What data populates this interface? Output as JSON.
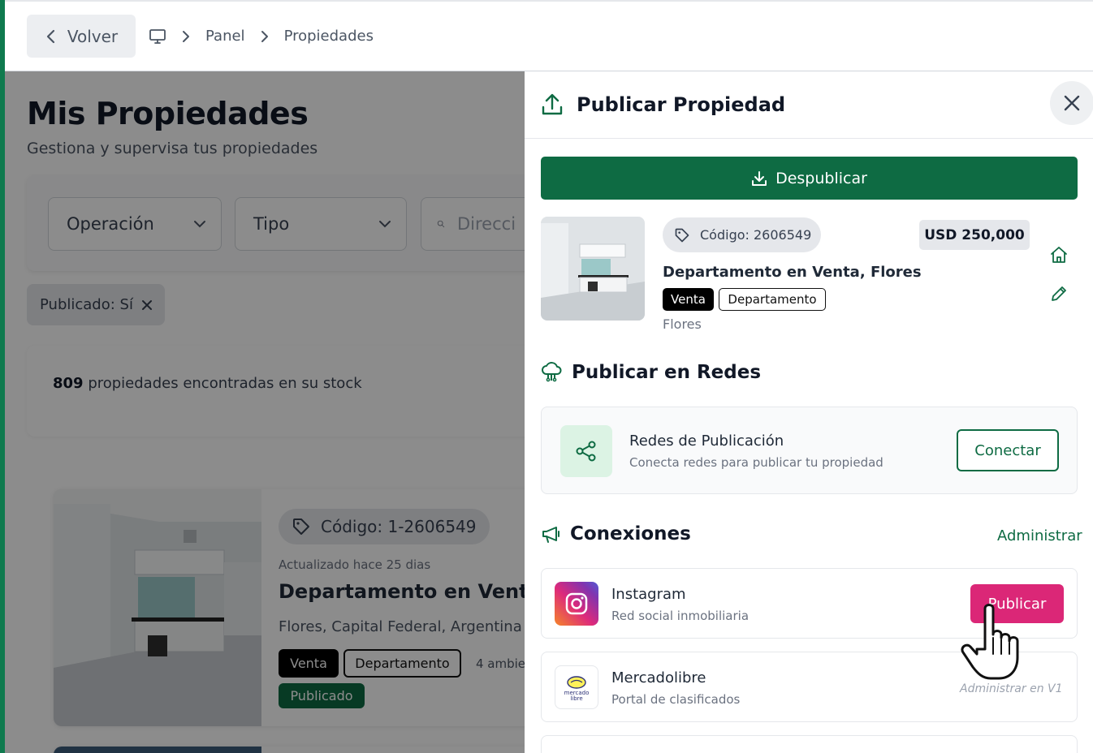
{
  "header": {
    "back_label": "Volver",
    "breadcrumbs": [
      "Panel",
      "Propiedades"
    ]
  },
  "page": {
    "title": "Mis Propiedades",
    "subtitle": "Gestiona y supervisa tus propiedades",
    "filters": {
      "operation": "Operación",
      "type": "Tipo",
      "search_placeholder": "Direcci"
    },
    "active_filter": "Publicado: Sí",
    "count": "809",
    "count_suffix": "propiedades encontradas en su stock",
    "card": {
      "code": "Código: 1-2606549",
      "updated": "Actualizado hace 25 dias",
      "title": "Departamento en Venta, Fl",
      "location": "Flores, Capital Federal, Argentina",
      "tags": [
        "Venta",
        "Departamento"
      ],
      "rooms": "4 ambie",
      "status": "Publicado"
    }
  },
  "panel": {
    "title": "Publicar Propiedad",
    "unpublish_label": "Despublicar",
    "property": {
      "code": "Código: 2606549",
      "price": "USD 250,000",
      "title": "Departamento en Venta, Flores",
      "tags": [
        "Venta",
        "Departamento"
      ],
      "location": "Flores"
    },
    "networks": {
      "section_title": "Publicar en Redes",
      "box_title": "Redes de Publicación",
      "box_subtitle": "Conecta redes para publicar tu propiedad",
      "connect_label": "Conectar"
    },
    "connections": {
      "section_title": "Conexiones",
      "manage_label": "Administrar",
      "items": [
        {
          "name": "Instagram",
          "description": "Red social inmobiliaria",
          "action": "Publicar"
        },
        {
          "name": "Mercadolibre",
          "description": "Portal de clasificados",
          "action": "Administrar en V1",
          "logo_text_1": "mercado",
          "logo_text_2": "libre"
        }
      ]
    }
  },
  "colors": {
    "brand_green": "#0e6b43",
    "instagram_pink": "#db2777"
  }
}
